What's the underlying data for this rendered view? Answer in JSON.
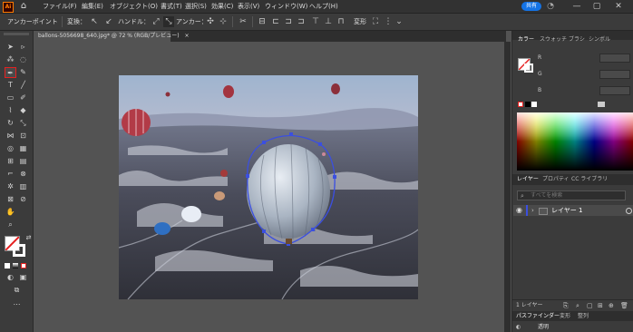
{
  "app": {
    "logo": "Ai",
    "window_controls": [
      "—",
      "▢",
      "✕"
    ]
  },
  "menu": {
    "items": [
      "ファイル(F)",
      "編集(E)",
      "オブジェクト(O)",
      "書式(T)",
      "選択(S)",
      "効果(C)",
      "表示(V)",
      "ウィンドウ(W)",
      "ヘルプ(H)"
    ],
    "share_label": "共有"
  },
  "controlbar": {
    "tool_name": "アンカーポイント",
    "convert_label": "変換：",
    "handle_label": "ハンドル：",
    "anchor_label": "アンカー：",
    "transform_label": "変形"
  },
  "document": {
    "tab_title": "ballons-5056698_640.jpg* @ 72 % (RGB/プレビュー)",
    "close_icon": "×"
  },
  "panels": {
    "color_tabs": [
      "カラー",
      "スウォッチ",
      "ブラシ",
      "シンボル"
    ],
    "channels": [
      "R",
      "G",
      "B"
    ],
    "layer_tabs": [
      "レイヤー",
      "プロパティ",
      "CC ライブラリ"
    ],
    "layer_search_placeholder": "すべてを検索",
    "layer_name": "レイヤー 1",
    "layer_count": "1 レイヤー",
    "bottom_tabs": [
      "パスファインダー",
      "変形",
      "整列"
    ],
    "transparency_label": "透明"
  },
  "colors": {
    "menubar": "#323232",
    "toolbar": "#3b3b3b",
    "canvas_bg": "#535353",
    "share": "#1473e6",
    "path_selection": "#3b4fe0",
    "pen_highlight": "#e62020"
  },
  "icons": {
    "home": "home-icon",
    "pen": "pen-tool-icon",
    "visibility": "eye-icon"
  }
}
